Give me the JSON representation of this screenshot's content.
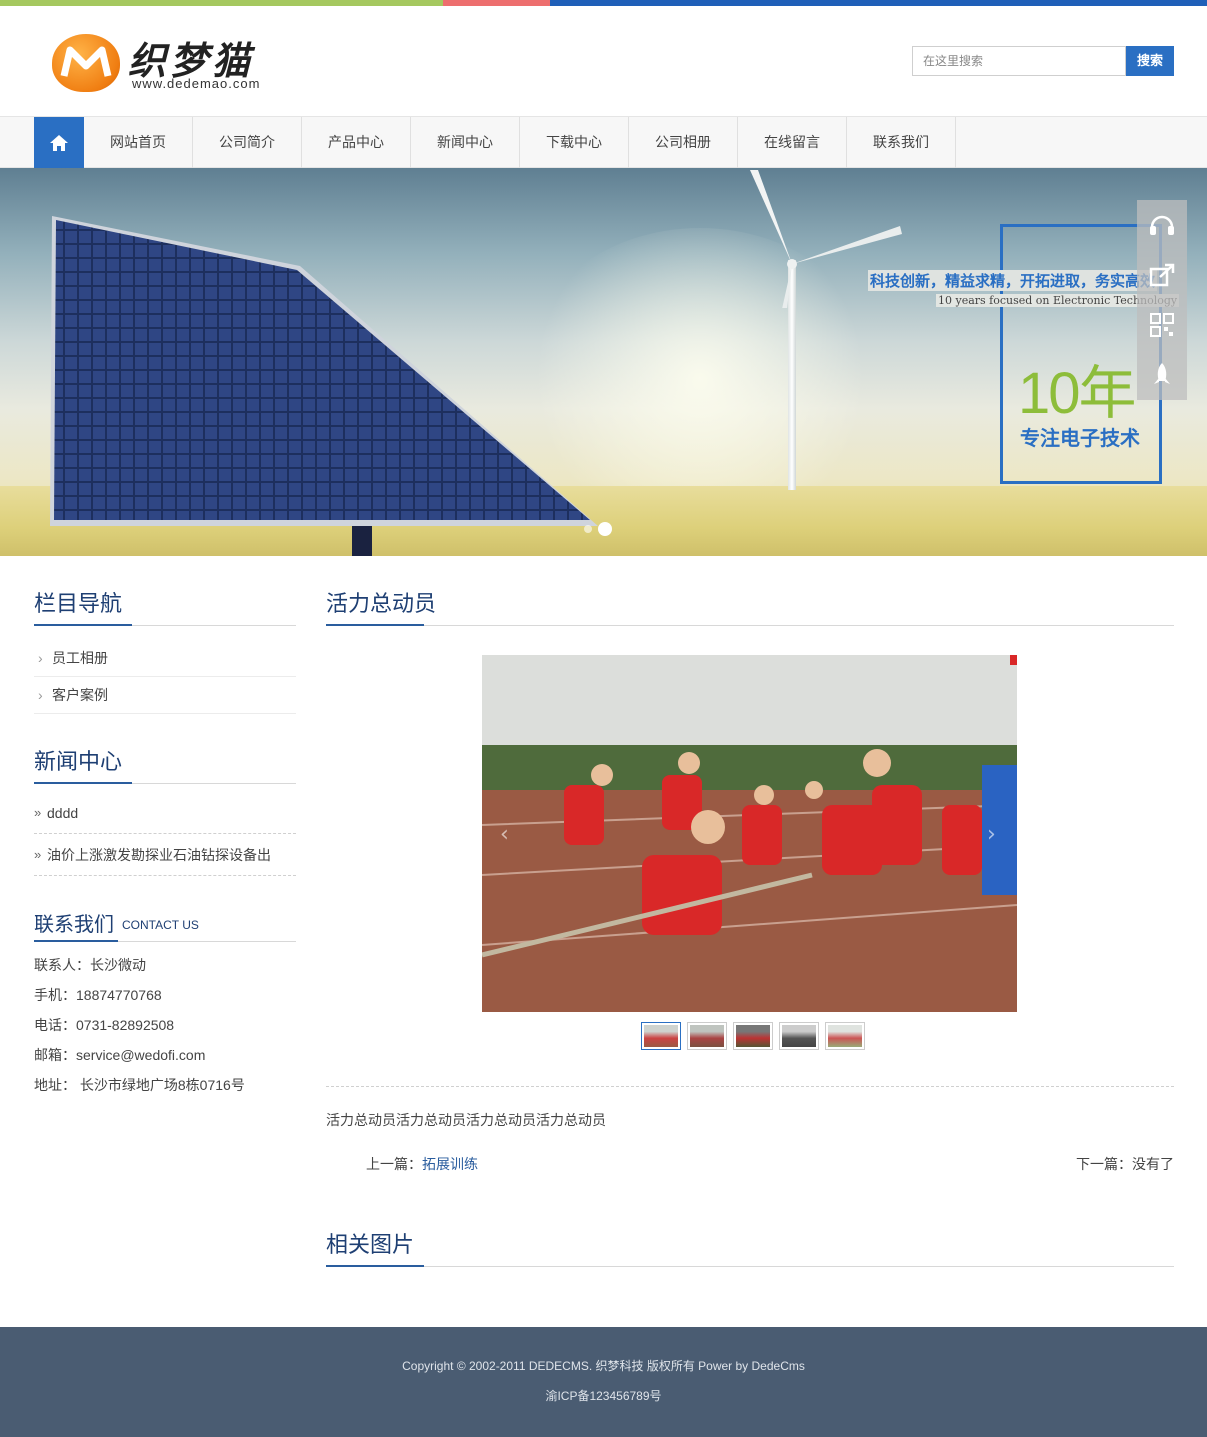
{
  "site": {
    "logo_cn": "织梦猫",
    "logo_en": "www.dedemao.com",
    "accent": "#2a6fc3"
  },
  "search": {
    "placeholder": "在这里搜索",
    "button": "搜索"
  },
  "nav": {
    "items": [
      "网站首页",
      "公司简介",
      "产品中心",
      "新闻中心",
      "下载中心",
      "公司相册",
      "在线留言",
      "联系我们"
    ]
  },
  "banner": {
    "slogan": "科技创新，精益求精，开拓进取，务实高效",
    "slogan_en": "10 years focused on Electronic Technology",
    "big": "10年",
    "sub": "专注电子技术"
  },
  "left": {
    "nav_title": "栏目导航",
    "nav_items": [
      "员工相册",
      "客户案例"
    ],
    "news_title": "新闻中心",
    "news_items": [
      "dddd",
      "油价上涨激发勘探业石油钻探设备出"
    ],
    "contact_title": "联系我们",
    "contact_en": "CONTACT US",
    "contact_lines": [
      "联系人：长沙微动",
      "手机：18874770768",
      "电话：0731-82892508",
      "邮箱：service@wedofi.com",
      "地址： 长沙市绿地广场8栋0716号"
    ]
  },
  "main": {
    "title": "活力总动员",
    "body": "活力总动员活力总动员活力总动员活力总动员",
    "prev_label": "上一篇：",
    "prev_link": "拓展训练",
    "next_label": "下一篇：没有了",
    "related_title": "相关图片"
  },
  "footer": {
    "copyright": "Copyright © 2002-2011 DEDECMS. 织梦科技 版权所有 Power by DedeCms",
    "icp": "渝ICP备123456789号"
  }
}
